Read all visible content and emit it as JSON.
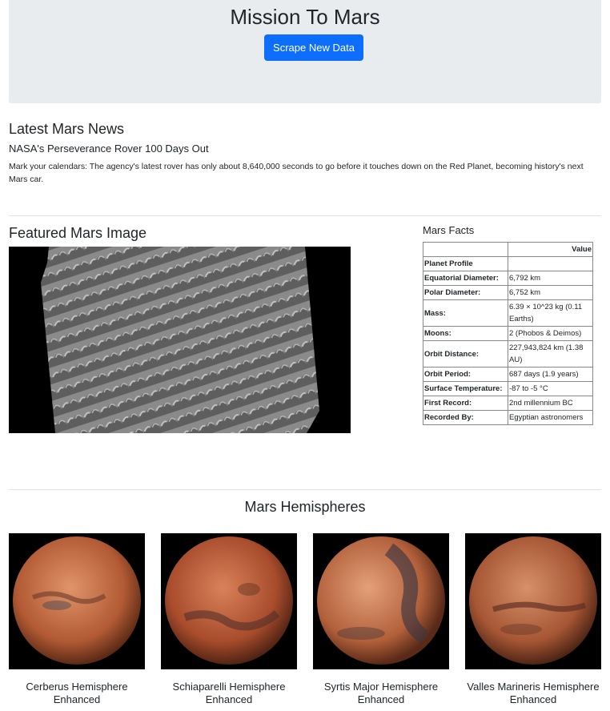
{
  "header": {
    "title": "Mission To Mars",
    "button_label": "Scrape New Data",
    "accent": "#0d6efd"
  },
  "news": {
    "section_title": "Latest Mars News",
    "headline": "NASA's Perseverance Rover 100 Days Out",
    "paragraph": "Mark your calendars: The agency's latest rover has only about 8,640,000 seconds to go before it touches down on the Red Planet, becoming history's next Mars car."
  },
  "featured": {
    "section_title": "Featured Mars Image"
  },
  "facts": {
    "section_title": "Mars Facts",
    "value_header": "Value",
    "rows": [
      {
        "label": "Planet Profile",
        "value": ""
      },
      {
        "label": "Equatorial Diameter:",
        "value": "6,792 km"
      },
      {
        "label": "Polar Diameter:",
        "value": "6,752 km"
      },
      {
        "label": "Mass:",
        "value": "6.39 × 10^23 kg (0.11 Earths)"
      },
      {
        "label": "Moons:",
        "value": "2 (Phobos & Deimos)"
      },
      {
        "label": "Orbit Distance:",
        "value": "227,943,824 km (1.38 AU)"
      },
      {
        "label": "Orbit Period:",
        "value": "687 days (1.9 years)"
      },
      {
        "label": "Surface Temperature:",
        "value": "-87 to -5 °C"
      },
      {
        "label": "First Record:",
        "value": "2nd millennium BC"
      },
      {
        "label": "Recorded By:",
        "value": "Egyptian astronomers"
      }
    ]
  },
  "hemispheres": {
    "section_title": "Mars Hemispheres",
    "items": [
      {
        "title": "Cerberus Hemisphere Enhanced"
      },
      {
        "title": "Schiaparelli Hemisphere Enhanced"
      },
      {
        "title": "Syrtis Major Hemisphere Enhanced"
      },
      {
        "title": "Valles Marineris Hemisphere Enhanced"
      }
    ]
  }
}
